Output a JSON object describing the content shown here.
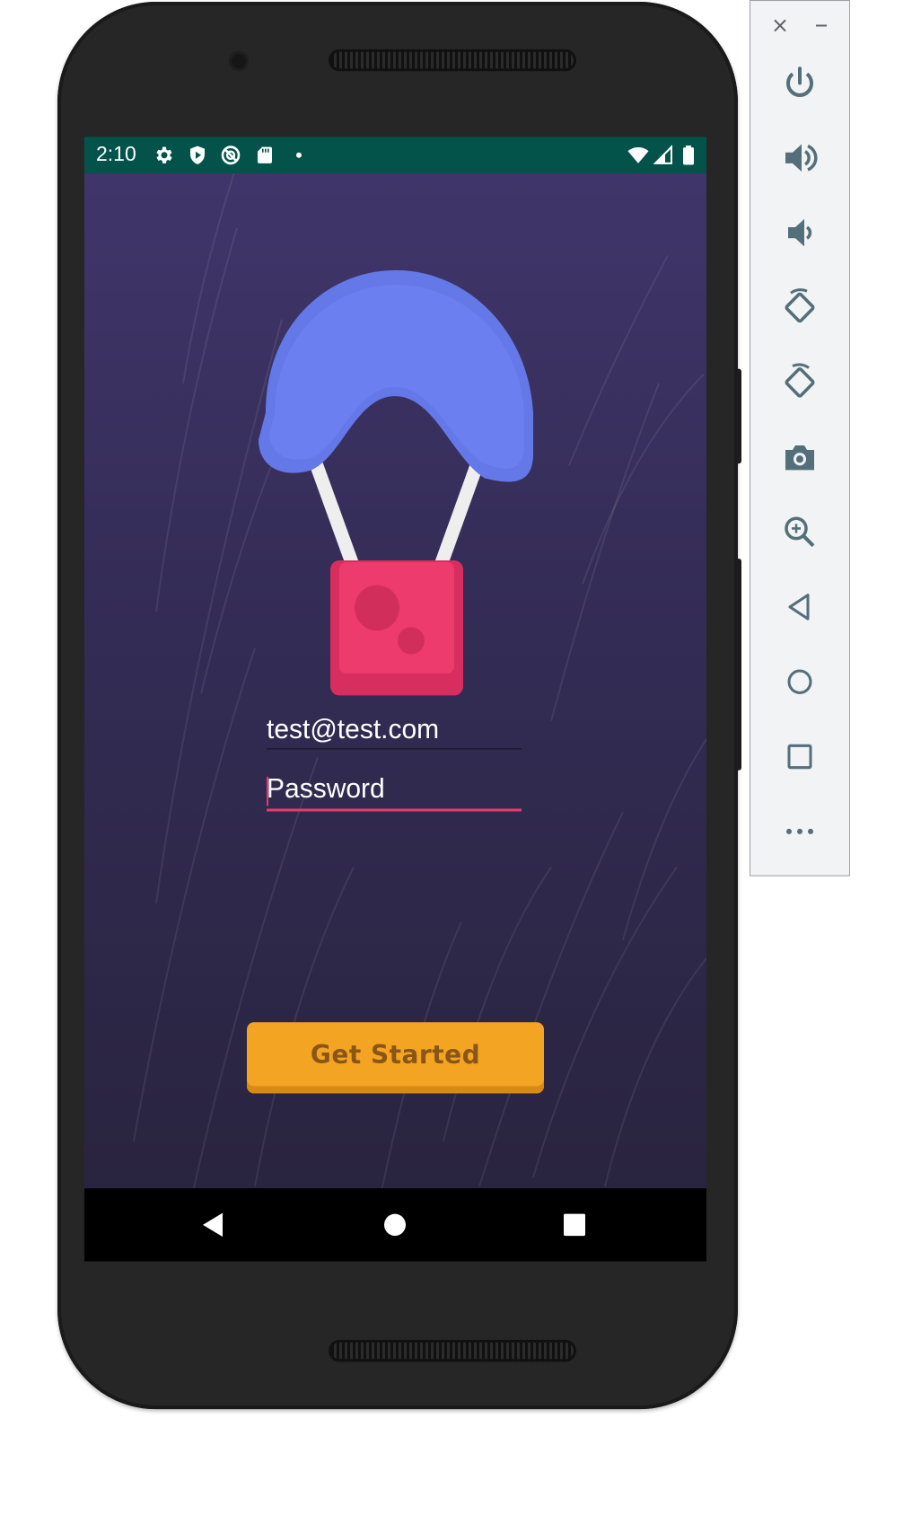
{
  "device": {
    "status_bar": {
      "time": "2:10",
      "left_icons": [
        "settings-icon",
        "shield-icon",
        "location-off-icon",
        "sd-card-icon",
        "notification-dot-icon"
      ],
      "right_icons": [
        "wifi-icon",
        "signal-icon",
        "battery-icon"
      ],
      "background_color": "#03534a"
    },
    "navigation_bar": {
      "buttons": [
        "back-button",
        "home-button",
        "recents-button"
      ]
    }
  },
  "app": {
    "background_colors": [
      "#40356a",
      "#29243f"
    ],
    "illustration": {
      "parachute_color": "#6b7ff0",
      "box_color": "#ee3b6e"
    },
    "email_field": {
      "value": "test@test.com"
    },
    "password_field": {
      "placeholder": "Password",
      "focused": true,
      "accent_color": "#e33b73"
    },
    "get_started_button": {
      "label": "Get Started",
      "color": "#f4a423"
    }
  },
  "emulator_panel": {
    "window_controls": [
      "close-icon",
      "minimize-icon"
    ],
    "tools": [
      {
        "name": "power-button",
        "icon": "power-icon"
      },
      {
        "name": "volume-up-button",
        "icon": "volume-up-icon"
      },
      {
        "name": "volume-down-button",
        "icon": "volume-down-icon"
      },
      {
        "name": "rotate-left-button",
        "icon": "rotate-left-icon"
      },
      {
        "name": "rotate-right-button",
        "icon": "rotate-right-icon"
      },
      {
        "name": "screenshot-button",
        "icon": "camera-icon"
      },
      {
        "name": "zoom-button",
        "icon": "zoom-in-icon"
      },
      {
        "name": "back-button",
        "icon": "back-triangle-icon"
      },
      {
        "name": "home-button",
        "icon": "home-circle-icon"
      },
      {
        "name": "overview-button",
        "icon": "overview-square-icon"
      },
      {
        "name": "more-button",
        "icon": "more-dots-icon"
      }
    ]
  }
}
